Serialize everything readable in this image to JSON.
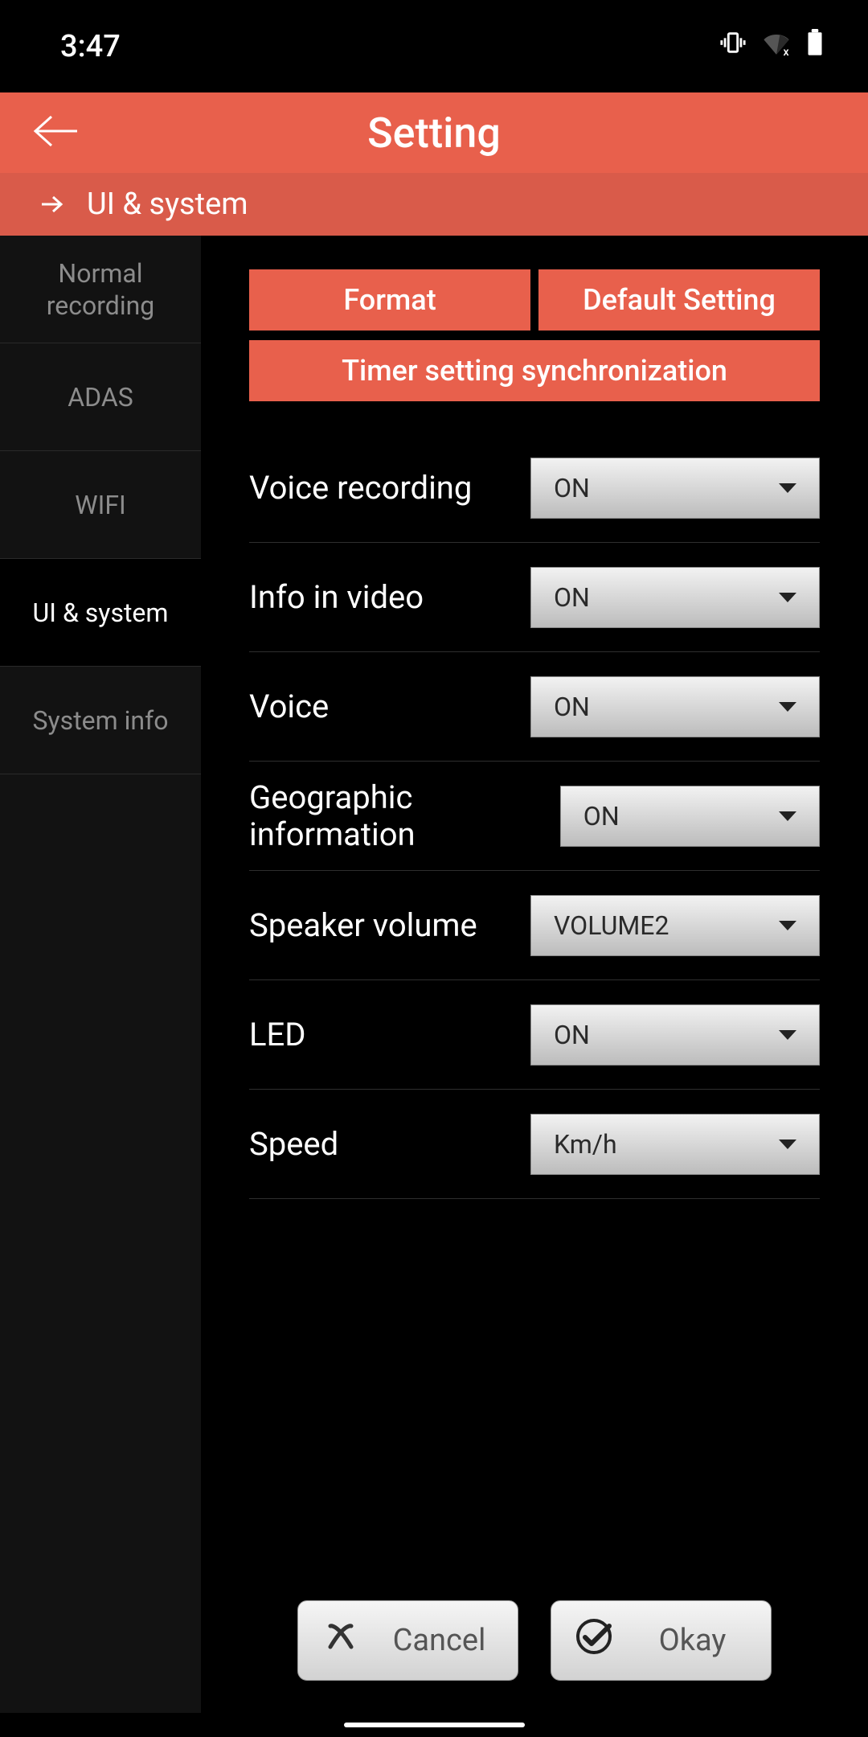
{
  "status": {
    "time": "3:47"
  },
  "header": {
    "title": "Setting"
  },
  "subheader": {
    "label": "UI & system"
  },
  "sidebar": {
    "items": [
      {
        "label": "Normal recording",
        "active": false
      },
      {
        "label": "ADAS",
        "active": false
      },
      {
        "label": "WIFI",
        "active": false
      },
      {
        "label": "UI & system",
        "active": true
      },
      {
        "label": "System info",
        "active": false
      }
    ]
  },
  "actions": {
    "format": "Format",
    "default": "Default Setting",
    "timer_sync": "Timer setting synchronization"
  },
  "settings": [
    {
      "label": "Voice recording",
      "value": "ON"
    },
    {
      "label": "Info in video",
      "value": "ON"
    },
    {
      "label": "Voice",
      "value": "ON"
    },
    {
      "label": "Geographic information",
      "value": "ON"
    },
    {
      "label": "Speaker volume",
      "value": "VOLUME2"
    },
    {
      "label": "LED",
      "value": "ON"
    },
    {
      "label": "Speed",
      "value": "Km/h"
    }
  ],
  "footer": {
    "cancel": "Cancel",
    "okay": "Okay"
  }
}
